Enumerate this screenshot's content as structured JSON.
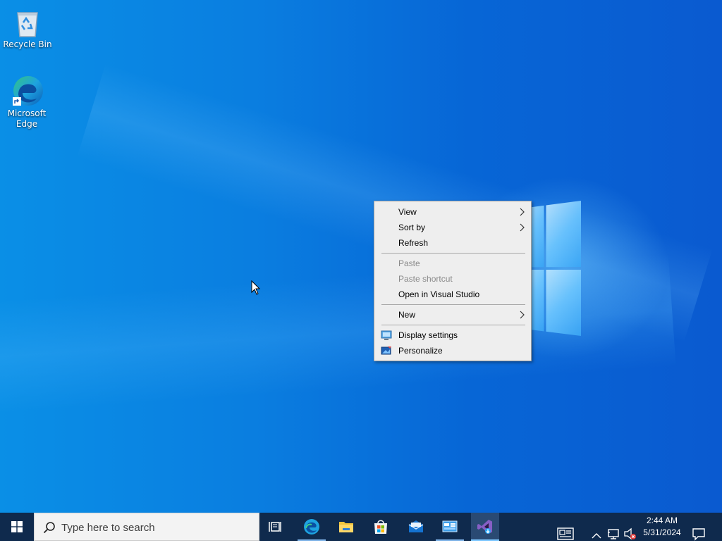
{
  "desktop": {
    "icons": [
      {
        "label": "Recycle Bin",
        "icon": "recycle-bin-icon"
      },
      {
        "label": "Microsoft Edge",
        "icon": "edge-icon"
      }
    ]
  },
  "context_menu": {
    "items": [
      {
        "label": "View",
        "submenu": true,
        "enabled": true
      },
      {
        "label": "Sort by",
        "submenu": true,
        "enabled": true
      },
      {
        "label": "Refresh",
        "submenu": false,
        "enabled": true
      },
      {
        "label": "Paste",
        "submenu": false,
        "enabled": false
      },
      {
        "label": "Paste shortcut",
        "submenu": false,
        "enabled": false
      },
      {
        "label": "Open in Visual Studio",
        "submenu": false,
        "enabled": true
      },
      {
        "label": "New",
        "submenu": true,
        "enabled": true
      },
      {
        "label": "Display settings",
        "submenu": false,
        "enabled": true,
        "icon": "display-settings-icon"
      },
      {
        "label": "Personalize",
        "submenu": false,
        "enabled": true,
        "icon": "personalize-icon"
      }
    ]
  },
  "taskbar": {
    "search": {
      "placeholder": "Type here to search"
    },
    "apps": [
      {
        "name": "Task View",
        "icon": "task-view-icon"
      },
      {
        "name": "Microsoft Edge",
        "icon": "edge-icon"
      },
      {
        "name": "File Explorer",
        "icon": "file-explorer-icon"
      },
      {
        "name": "Microsoft Store",
        "icon": "store-icon"
      },
      {
        "name": "Mail",
        "icon": "mail-icon"
      },
      {
        "name": "Control Panel",
        "icon": "control-panel-icon"
      },
      {
        "name": "Visual Studio",
        "icon": "visual-studio-icon",
        "active": true
      }
    ],
    "tray": {
      "time": "2:44 AM",
      "date": "5/31/2024",
      "icons": [
        "news-icon",
        "chevron-up-icon",
        "network-icon",
        "volume-muted-icon",
        "notification-icon"
      ]
    }
  },
  "colors": {
    "desktop_background": "#0a7ee0",
    "taskbar": "#0f2a4d",
    "menu_background": "#eeeeee",
    "disabled_text": "#8a8a8a"
  }
}
